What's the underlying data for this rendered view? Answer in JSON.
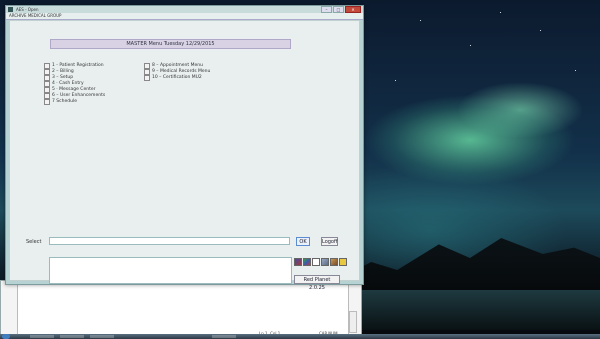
{
  "window": {
    "title": "AES - Open",
    "subtitle": "ARCHIVE MEDICAL GROUP",
    "btn_min": "–",
    "btn_max": "□",
    "btn_close": "✕"
  },
  "header": {
    "text": "MASTER Menu  Tuesday  12/29/2015"
  },
  "menu_left": [
    {
      "label": "1 - Patient Registration"
    },
    {
      "label": "2 – Billing"
    },
    {
      "label": "3 – Setup"
    },
    {
      "label": "4 · Cash Entry"
    },
    {
      "label": "5 · Message Center"
    },
    {
      "label": "6 – User Enhancements"
    },
    {
      "label": "7  Schedule"
    }
  ],
  "menu_right": [
    {
      "label": "8 – Appointment Menu"
    },
    {
      "label": "9 – Medical Records Menu"
    },
    {
      "label": "10 – Certification MU2"
    }
  ],
  "select": {
    "label": "Select",
    "value": "",
    "placeholder": ""
  },
  "buttons": {
    "ok": "OK",
    "logoff": "Logoff",
    "version": "Red Planet 2.0.25"
  },
  "toolbar_icons": [
    {
      "name": "palette-icon",
      "color": "#4a4aa0"
    },
    {
      "name": "colors-icon",
      "color": "#3aa040"
    },
    {
      "name": "blank-icon",
      "color": "#ffffff"
    },
    {
      "name": "tools-icon",
      "color": "#7a8aa8"
    },
    {
      "name": "image-icon",
      "color": "#a87a3a"
    },
    {
      "name": "note-icon",
      "color": "#e8c840"
    }
  ],
  "background_window": {
    "status_left": "Ln 1, Col 1",
    "status_right": "CAP  NUM"
  }
}
